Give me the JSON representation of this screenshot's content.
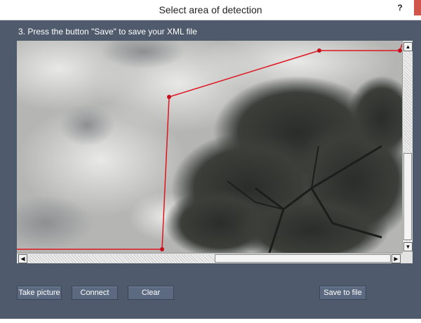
{
  "window": {
    "title": "Select area of detection",
    "help_label": "?"
  },
  "instruction": "3. Press the button \"Save\" to save your XML file",
  "scrollbars": {
    "up_arrow": "▲",
    "down_arrow": "▼",
    "left_arrow": "◀",
    "right_arrow": "▶"
  },
  "buttons": {
    "take_picture": "Take picture",
    "connect": "Connect",
    "clear": "Clear",
    "save_to_file": "Save to file"
  },
  "colors": {
    "client_bg": "#4f5b6c",
    "button_bg": "#5b6a80",
    "polygon_line": "#e0141e",
    "close_button": "#d0564c"
  },
  "icons": {
    "help": "help-icon",
    "close": "close-icon"
  }
}
